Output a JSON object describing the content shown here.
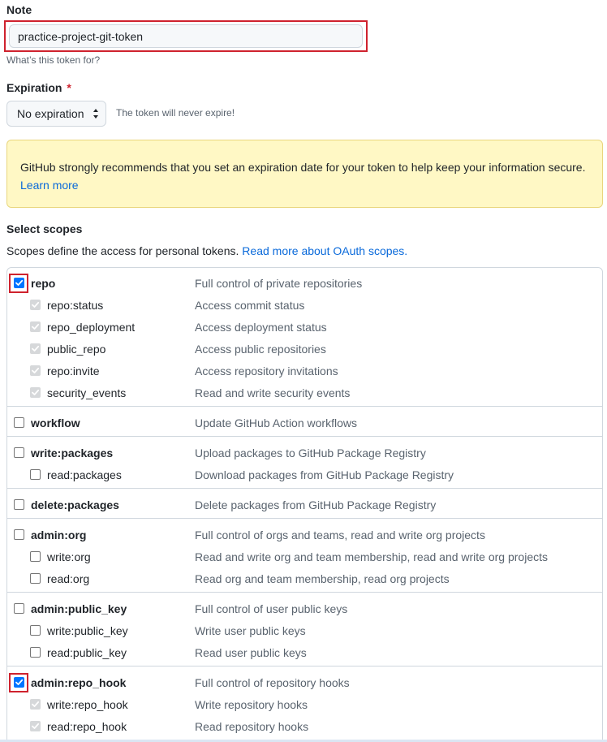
{
  "note": {
    "label": "Note",
    "value": "practice-project-git-token",
    "help": "What’s this token for?"
  },
  "expiration": {
    "label": "Expiration",
    "required_mark": "*",
    "selected": "No expiration",
    "note": "The token will never expire!"
  },
  "flash": {
    "text": "GitHub strongly recommends that you set an expiration date for your token to help keep your information secure.",
    "link": "Learn more"
  },
  "scopes": {
    "title": "Select scopes",
    "desc": "Scopes define the access for personal tokens.",
    "desc_link": "Read more about OAuth scopes.",
    "groups": [
      {
        "name": "repo",
        "desc": "Full control of private repositories",
        "checked": true,
        "children": [
          {
            "name": "repo:status",
            "desc": "Access commit status"
          },
          {
            "name": "repo_deployment",
            "desc": "Access deployment status"
          },
          {
            "name": "public_repo",
            "desc": "Access public repositories"
          },
          {
            "name": "repo:invite",
            "desc": "Access repository invitations"
          },
          {
            "name": "security_events",
            "desc": "Read and write security events"
          }
        ]
      },
      {
        "name": "workflow",
        "desc": "Update GitHub Action workflows",
        "checked": false,
        "children": []
      },
      {
        "name": "write:packages",
        "desc": "Upload packages to GitHub Package Registry",
        "checked": false,
        "children": [
          {
            "name": "read:packages",
            "desc": "Download packages from GitHub Package Registry"
          }
        ]
      },
      {
        "name": "delete:packages",
        "desc": "Delete packages from GitHub Package Registry",
        "checked": false,
        "children": []
      },
      {
        "name": "admin:org",
        "desc": "Full control of orgs and teams, read and write org projects",
        "checked": false,
        "children": [
          {
            "name": "write:org",
            "desc": "Read and write org and team membership, read and write org projects"
          },
          {
            "name": "read:org",
            "desc": "Read org and team membership, read org projects"
          }
        ]
      },
      {
        "name": "admin:public_key",
        "desc": "Full control of user public keys",
        "checked": false,
        "children": [
          {
            "name": "write:public_key",
            "desc": "Write user public keys"
          },
          {
            "name": "read:public_key",
            "desc": "Read user public keys"
          }
        ]
      },
      {
        "name": "admin:repo_hook",
        "desc": "Full control of repository hooks",
        "checked": true,
        "children": [
          {
            "name": "write:repo_hook",
            "desc": "Write repository hooks"
          },
          {
            "name": "read:repo_hook",
            "desc": "Read repository hooks"
          }
        ]
      }
    ]
  },
  "colors": {
    "highlight": "#cf222e",
    "checkbox_checked": "#0075ff",
    "link": "#0969da",
    "flash_bg": "#fff8c5"
  }
}
